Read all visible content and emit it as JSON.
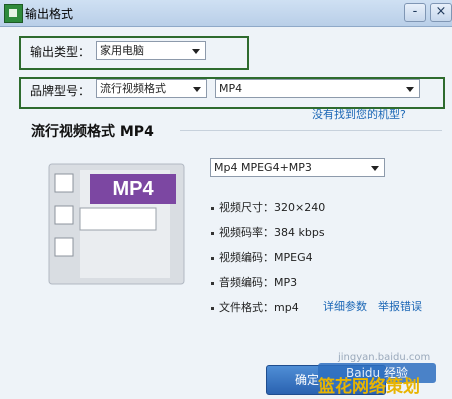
{
  "window": {
    "title": "输出格式",
    "minimize_glyph": "-",
    "close_glyph": "×"
  },
  "output": {
    "type_label": "输出类型：",
    "type_value": "家用电脑"
  },
  "brand": {
    "label": "品牌型号：",
    "value": "流行视频格式",
    "model_value": "MP4",
    "missing_model_link": "没有找到您的机型?"
  },
  "format": {
    "title": "流行视频格式  MP4",
    "badge": "MP4",
    "select_value": "Mp4 MPEG4+MP3",
    "rows": [
      {
        "label": "视频尺寸：",
        "value": "320×240"
      },
      {
        "label": "视频码率：",
        "value": "384 kbps"
      },
      {
        "label": "视频编码：",
        "value": "MPEG4"
      },
      {
        "label": "音频编码：",
        "value": "MP3"
      },
      {
        "label": "文件格式：",
        "value": "mp4"
      }
    ],
    "detail_link": "详细参数",
    "report_link": "举报错误"
  },
  "buttons": {
    "confirm": "确定"
  },
  "watermark": {
    "box": "Baidu 经验",
    "text": "篮花网络策划",
    "url": "jingyan.baidu.com"
  },
  "colors": {
    "group_border": "#2e6b2e",
    "badge_purple": "#7c47a2",
    "link_blue": "#1a66b5"
  }
}
